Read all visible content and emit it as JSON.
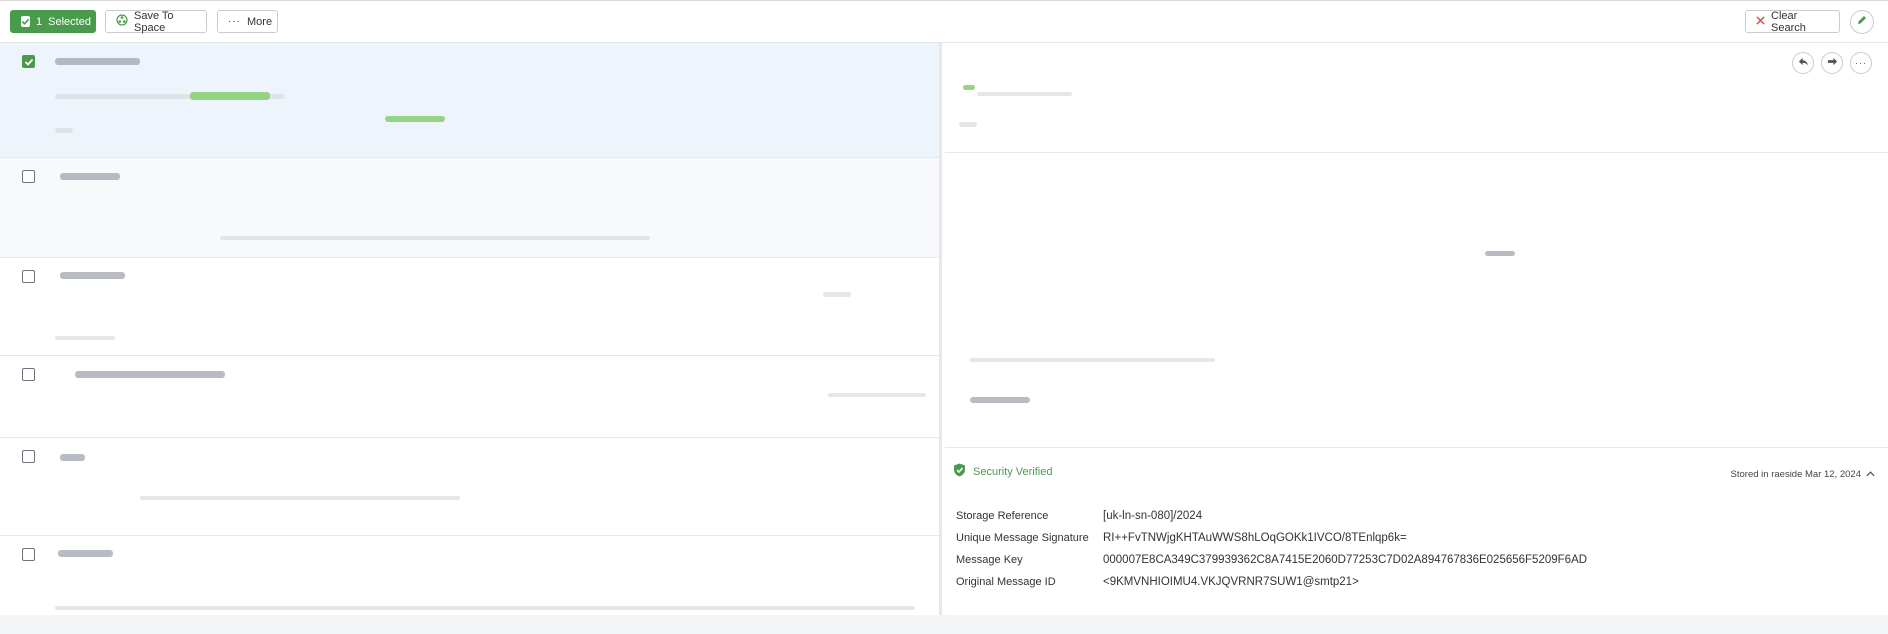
{
  "toolbar": {
    "selected_count": "1",
    "selected_label": "Selected",
    "save_label": "Save To Space",
    "more_label": "More",
    "clear_label": "Clear Search"
  },
  "detail": {
    "security_label": "Security Verified",
    "stored_label": "Stored in raeside Mar 12, 2024",
    "meta": [
      {
        "key": "Storage Reference",
        "value": "[uk-ln-sn-080]/2024"
      },
      {
        "key": "Unique Message Signature",
        "value": "RI++FvTNWjgKHTAuWWS8hLOqGOKk1IVCO/8TEnlqp6k="
      },
      {
        "key": "Message Key",
        "value": "000007E8CA349C379939362C8A7415E2060D77253C7D02A894767836E025656F5209F6AD"
      },
      {
        "key": "Original Message ID",
        "value": "<9KMVNHIOIMU4.VKJQVRNR7SUW1@smtp21>"
      }
    ]
  },
  "colors": {
    "accent": "#4a9a4e",
    "selected_row": "#eef4fb"
  },
  "icons": [
    "checkbox-icon",
    "save-space-icon",
    "more-dots-icon",
    "close-icon",
    "edit-icon",
    "reply-icon",
    "forward-icon",
    "shield-check-icon",
    "chevron-up-icon"
  ]
}
